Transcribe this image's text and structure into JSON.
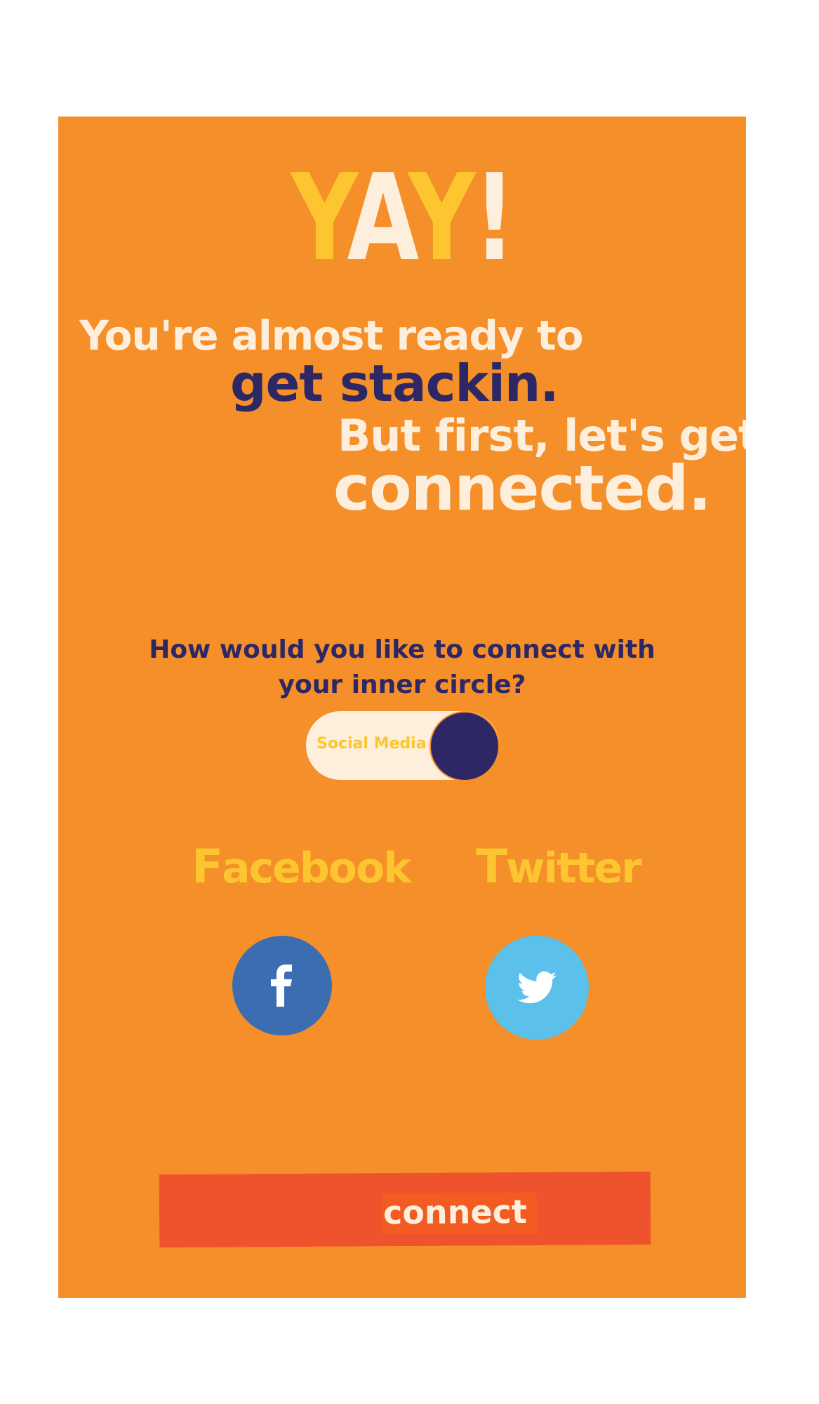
{
  "heading": {
    "y1": "Y",
    "a": "A",
    "y2": "Y",
    "bang": "!"
  },
  "tagline": {
    "line1": "You're almost ready to",
    "line2": "get stackin.",
    "line3": "But first, let's get",
    "line4": "connected."
  },
  "question": {
    "line1": "How would you like to connect with",
    "line2": "your inner circle?"
  },
  "toggle": {
    "label": "Social Media",
    "state": "on"
  },
  "social": {
    "facebook": {
      "first": "F",
      "rest": "acebook",
      "icon": "facebook-icon"
    },
    "twitter": {
      "first": "T",
      "rest": "witter",
      "icon": "twitter-bird-icon"
    }
  },
  "connect": {
    "label": "connect"
  },
  "colors": {
    "background": "#f58f2a",
    "navy": "#2d2766",
    "cream": "#fdefdc",
    "yellow": "#fdc52f",
    "facebook": "#3c6db1",
    "twitter": "#5bc0ea",
    "connect": "#ef532d"
  }
}
